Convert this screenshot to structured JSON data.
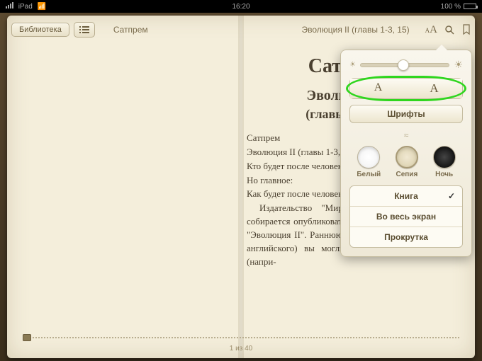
{
  "status_bar": {
    "carrier": "iPad",
    "time": "16:20",
    "battery_pct": "100 %"
  },
  "toolbar": {
    "library_label": "Библиотека",
    "book_title": "Сатпрем",
    "chapter_title": "Эволюция II (главы 1-3, 15)"
  },
  "content": {
    "h1": "Сатпрем",
    "h2": "Эволюция II",
    "h3": "(главы 1-3, 15)",
    "lines": {
      "l1": "Сатпрем",
      "l2": "Эволюция II (главы 1-3, 15)",
      "l3": "Кто будет после человека?",
      "l4": "Но главное:",
      "l5": "Как будет после человека?"
    },
    "paragraph": "Издательство \"Мирра\" в скором вре­мени собирается опубликовать перевод книги Сатпрема \"Эволюция II\". Раннюю версию этого перевода (с английского) вы могли встречать в Интернете (напри-"
  },
  "popover": {
    "font_small": "A",
    "font_large": "A",
    "fonts_label": "Шрифты",
    "themes": {
      "white": "Белый",
      "sepia": "Сепия",
      "night": "Ночь"
    },
    "layouts": {
      "book": "Книга",
      "fullscreen": "Во весь экран",
      "scroll": "Прокрутка"
    }
  },
  "footer": {
    "page_of": "1 из 40"
  }
}
